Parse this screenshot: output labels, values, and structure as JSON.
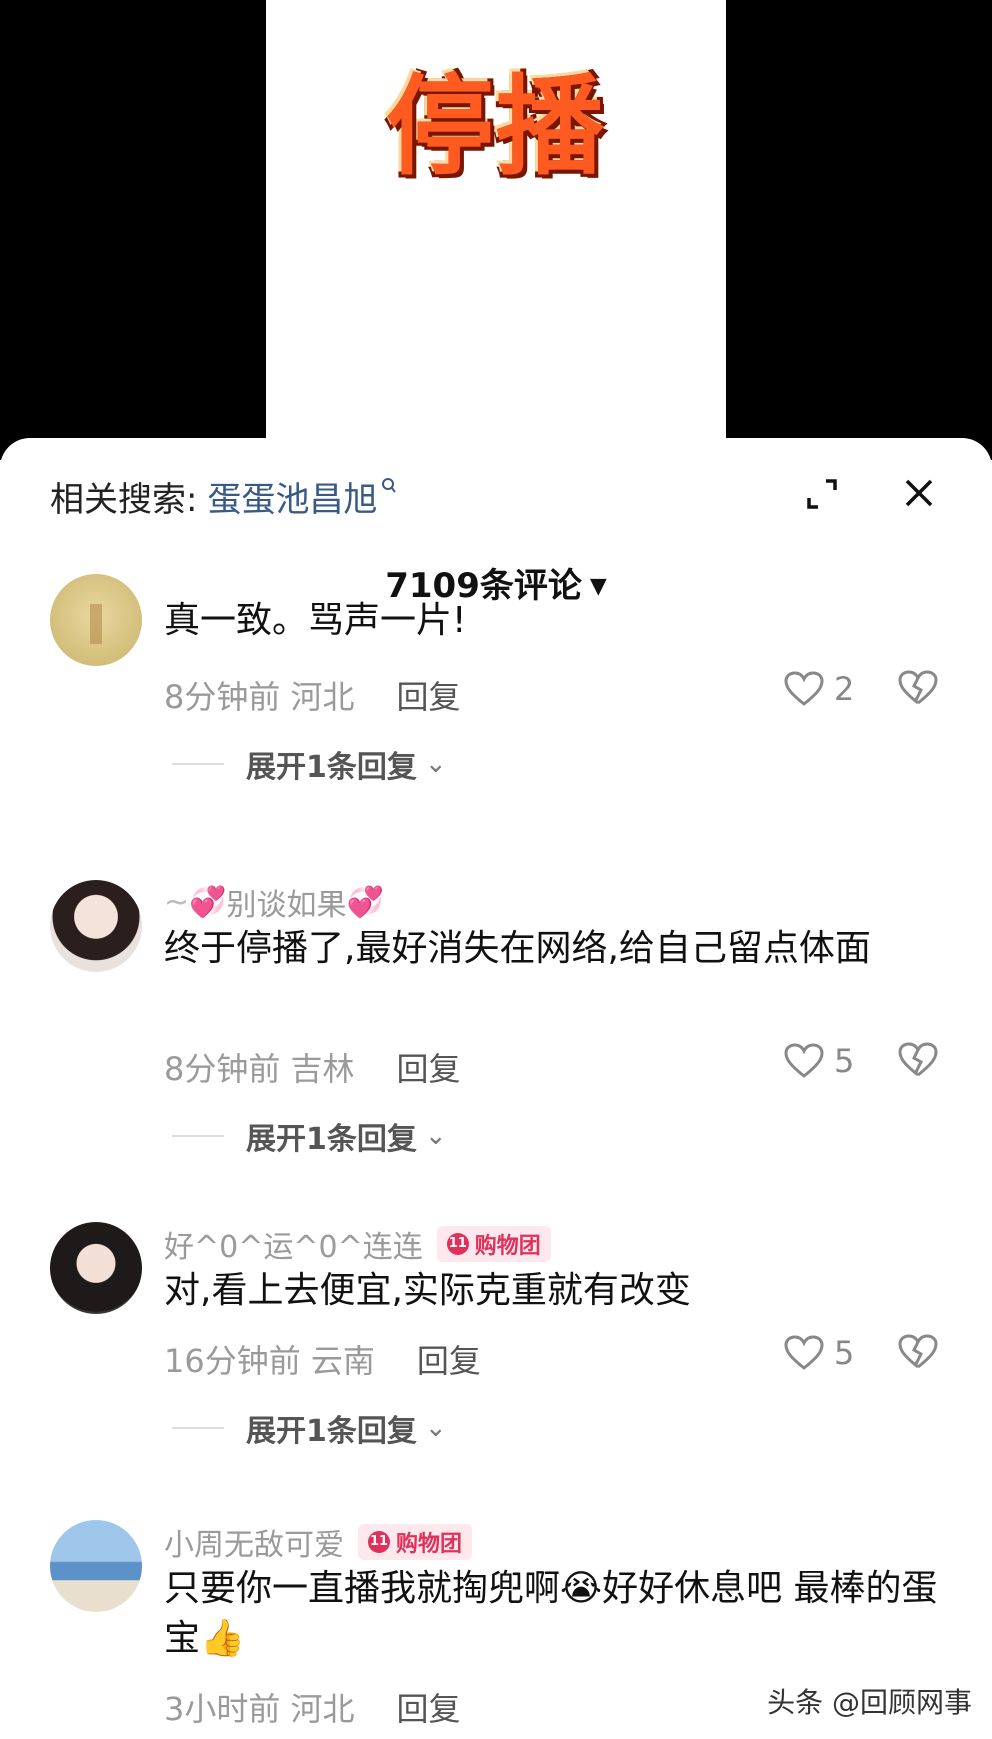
{
  "video": {
    "title": "停播"
  },
  "sheet": {
    "related_label": "相关搜索:",
    "related_keyword": "蛋蛋池昌旭",
    "comment_count": "7109条评论"
  },
  "comments": [
    {
      "name": "",
      "badge": "",
      "text": "真一致。骂声一片!",
      "time_location": "8分钟前 河北",
      "reply": "回复",
      "likes": "2",
      "expand": "展开1条回复"
    },
    {
      "name": "别谈如果",
      "badge": "",
      "text": "终于停播了,最好消失在网络,给自己留点体面",
      "time_location": "8分钟前 吉林",
      "reply": "回复",
      "likes": "5",
      "expand": "展开1条回复"
    },
    {
      "name": "好^0^运^0^连连",
      "badge": "购物团",
      "badge_level": "11",
      "text": "对,看上去便宜,实际克重就有改变",
      "time_location": "16分钟前 云南",
      "reply": "回复",
      "likes": "5",
      "expand": "展开1条回复"
    },
    {
      "name": "小周无敌可爱",
      "badge": "购物团",
      "badge_level": "11",
      "text": "只要你一直播我就掏兜啊😭好好休息吧 最棒的蛋宝👍",
      "time_location": "3小时前 河北",
      "reply": "回复"
    }
  ],
  "watermark": "头条 @回顾网事",
  "colors": {
    "accent_link": "#3a5a86",
    "badge": "#e0315b",
    "meta_gray": "#9a9a9a"
  }
}
